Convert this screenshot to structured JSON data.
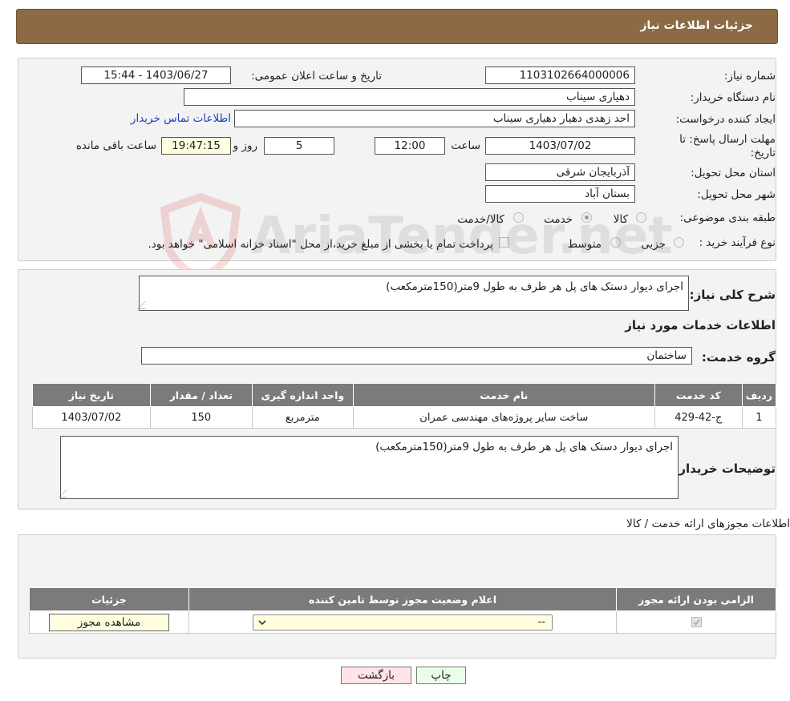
{
  "header": {
    "title": "جزئیات اطلاعات نیاز"
  },
  "info": {
    "need_number_label": "شماره نیاز:",
    "need_number": "1103102664000006",
    "announce_label": "تاریخ و ساعت اعلان عمومی:",
    "announce_value": "1403/06/27 - 15:44",
    "buyer_org_label": "نام دستگاه خریدار:",
    "buyer_org": "دهیاری سیناب",
    "creator_label": "ایجاد کننده درخواست:",
    "creator": "احد زهدی دهیار دهیاری سیناب",
    "contact_link": "اطلاعات تماس خریدار",
    "deadline_label_1": "مهلت ارسال پاسخ: تا",
    "deadline_label_2": "تاریخ:",
    "deadline_date": "1403/07/02",
    "time_label": "ساعت",
    "deadline_time": "12:00",
    "days_value": "5",
    "days_label": "روز و",
    "remaining_time": "19:47:15",
    "remaining_label": "ساعت باقی مانده",
    "province_label": "استان محل تحویل:",
    "province": "آذربایجان شرقی",
    "city_label": "شهر محل تحویل:",
    "city": "بستان آباد",
    "category_label": "طبقه بندی موضوعی:",
    "category_options": [
      "کالا",
      "خدمت",
      "کالا/خدمت"
    ],
    "category_selected": "خدمت",
    "process_label": "نوع فرآیند خرید :",
    "process_options": [
      "جزیی",
      "متوسط"
    ],
    "process_note": "پرداخت تمام یا بخشی از مبلغ خرید،از محل \"اسناد خزانه اسلامی\" خواهد بود."
  },
  "description": {
    "label": "شرح کلی نیاز:",
    "text": "اجرای دیوار دستک های پل هر طرف به طول 9متر(150مترمکعب)",
    "services_heading": "اطلاعات خدمات مورد نیاز",
    "group_label": "گروه خدمت:",
    "group_value": "ساختمان"
  },
  "services_table": {
    "headers": [
      "ردیف",
      "کد خدمت",
      "نام خدمت",
      "واحد اندازه گیری",
      "تعداد / مقدار",
      "تاریخ نیاز"
    ],
    "rows": [
      [
        "1",
        "ج-42-429",
        "ساخت سایر پروژه‌های مهندسی عمران",
        "مترمربع",
        "150",
        "1403/07/02"
      ]
    ]
  },
  "buyer_notes": {
    "label": "توضیحات خریدار:",
    "text": "اجرای دیوار دستک های پل هر طرف به طول 9متر(150مترمکعب)"
  },
  "permits": {
    "heading": "اطلاعات مجوزهای ارائه خدمت / کالا",
    "headers": [
      "الزامی بودن ارائه مجوز",
      "اعلام وضعیت مجوز توسط تامین کننده",
      "جزئیات"
    ],
    "select_value": "--",
    "view_button": "مشاهده مجوز"
  },
  "footer": {
    "print_button": "چاپ",
    "back_button": "بازگشت"
  },
  "watermark": "AriaTender.net"
}
